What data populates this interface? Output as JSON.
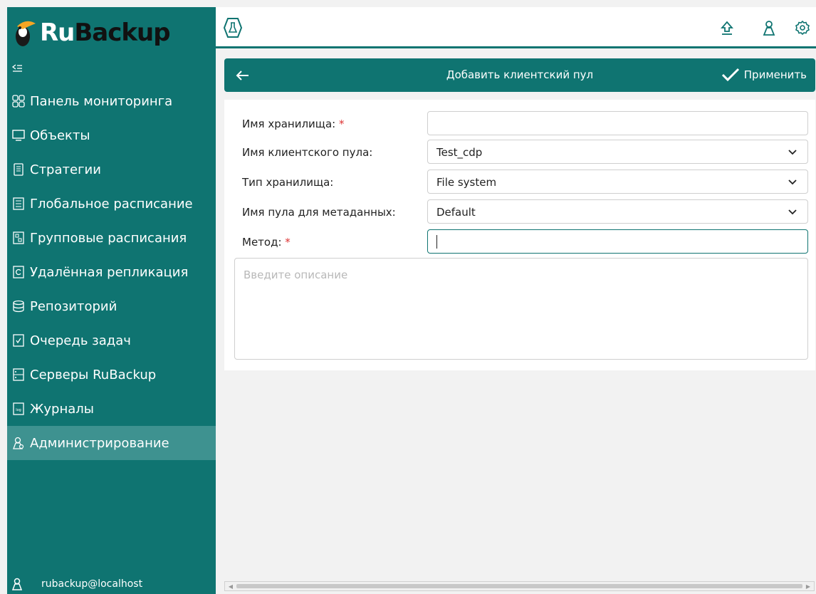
{
  "brand": {
    "ru": "Ru",
    "backup": "Backup"
  },
  "sidebar": {
    "items": [
      {
        "label": "Панель мониторинга",
        "icon": "dashboard-icon"
      },
      {
        "label": "Объекты",
        "icon": "monitor-icon"
      },
      {
        "label": "Стратегии",
        "icon": "document-icon"
      },
      {
        "label": "Глобальное расписание",
        "icon": "list-icon"
      },
      {
        "label": "Групповые расписания",
        "icon": "group-schedule-icon"
      },
      {
        "label": "Удалённая репликация",
        "icon": "replication-icon"
      },
      {
        "label": "Репозиторий",
        "icon": "database-icon"
      },
      {
        "label": "Очередь задач",
        "icon": "task-queue-icon"
      },
      {
        "label": "Серверы RuBackup",
        "icon": "server-icon"
      },
      {
        "label": "Журналы",
        "icon": "log-icon"
      },
      {
        "label": "Администрирование",
        "icon": "admin-icon",
        "active": true
      }
    ],
    "user": "rubackup@localhost"
  },
  "header": {
    "title": "Добавить клиентский пул",
    "apply_label": "Применить"
  },
  "form": {
    "storage_name": {
      "label": "Имя хранилища:",
      "required": "*",
      "value": ""
    },
    "client_pool": {
      "label": "Имя клиентского пула:",
      "value": "Test_cdp"
    },
    "storage_type": {
      "label": "Тип хранилища:",
      "value": "File system"
    },
    "metadata_pool": {
      "label": "Имя пула для метаданных:",
      "value": "Default"
    },
    "method": {
      "label": "Метод:",
      "required": "*",
      "value": ""
    },
    "description": {
      "placeholder": "Введите описание"
    }
  },
  "colors": {
    "accent": "#0f7471",
    "active_item": "#3e9290",
    "required": "#dd3333"
  }
}
